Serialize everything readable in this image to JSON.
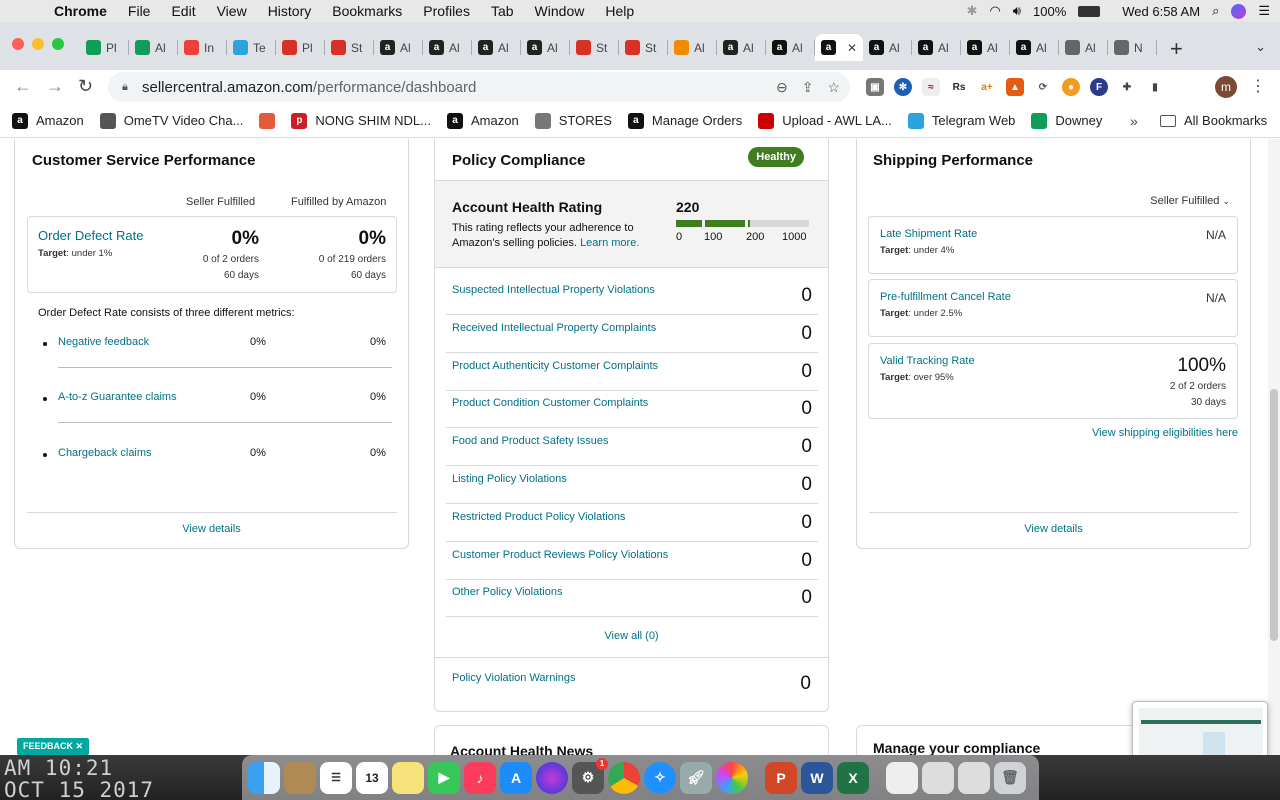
{
  "menubar": {
    "app": "Chrome",
    "items": [
      "File",
      "Edit",
      "View",
      "History",
      "Bookmarks",
      "Profiles",
      "Tab",
      "Window",
      "Help"
    ],
    "battery": "100%",
    "clock": "Wed 6:58 AM"
  },
  "tabs": [
    {
      "letter": "Pl",
      "icon": "sheets-icon",
      "color": "#0f9d58"
    },
    {
      "letter": "Al",
      "icon": "sheets-icon",
      "color": "#0f9d58"
    },
    {
      "letter": "In",
      "icon": "gmail-icon",
      "color": "#ea4335"
    },
    {
      "letter": "Te",
      "icon": "telegram-icon",
      "color": "#2aa3e0"
    },
    {
      "letter": "Pl",
      "icon": "peppermint-icon",
      "color": "#d93025"
    },
    {
      "letter": "St",
      "icon": "peppermint-icon",
      "color": "#d93025"
    },
    {
      "letter": "Al",
      "icon": "amazon-icon",
      "color": "#222"
    },
    {
      "letter": "Al",
      "icon": "amazon-icon",
      "color": "#222"
    },
    {
      "letter": "Al",
      "icon": "amazon-icon",
      "color": "#222"
    },
    {
      "letter": "Al",
      "icon": "amazon-icon",
      "color": "#222"
    },
    {
      "letter": "St",
      "icon": "peppermint-icon",
      "color": "#d93025"
    },
    {
      "letter": "St",
      "icon": "peppermint-icon",
      "color": "#d93025"
    },
    {
      "letter": "Al",
      "icon": "pencil-icon",
      "color": "#f28b00"
    },
    {
      "letter": "Al",
      "icon": "amazon-icon",
      "color": "#222"
    },
    {
      "letter": "Al",
      "icon": "amazon-icon",
      "color": "#111"
    },
    {
      "letter": "",
      "icon": "amazon-icon",
      "color": "#111",
      "active": true
    },
    {
      "letter": "Al",
      "icon": "amazon-icon",
      "color": "#111"
    },
    {
      "letter": "Al",
      "icon": "amazon-icon",
      "color": "#111"
    },
    {
      "letter": "Al",
      "icon": "amazon-icon",
      "color": "#111"
    },
    {
      "letter": "Al",
      "icon": "amazon-icon",
      "color": "#111"
    },
    {
      "letter": "Al",
      "icon": "globe-icon",
      "color": "#666"
    },
    {
      "letter": "N",
      "icon": "chrome-icon",
      "color": "#666"
    }
  ],
  "url": {
    "host": "sellercentral.amazon.com",
    "path": "/performance/dashboard"
  },
  "bookmarks": [
    {
      "label": "Amazon",
      "icon": "amazon-icon",
      "color": "#111"
    },
    {
      "label": "OmeTV Video Cha...",
      "icon": "globe-icon",
      "color": "#555"
    },
    {
      "label": "",
      "icon": "gift-icon",
      "color": "#e35b3b"
    },
    {
      "label": "NONG SHIM NDL...",
      "icon": "pinterest-icon",
      "color": "#cb1f27"
    },
    {
      "label": "Amazon",
      "icon": "amazon-icon",
      "color": "#111"
    },
    {
      "label": "STORES",
      "icon": "folder-icon",
      "color": "#777"
    },
    {
      "label": "Manage Orders",
      "icon": "amazon-icon",
      "color": "#111"
    },
    {
      "label": "Upload - AWL LA...",
      "icon": "awl-icon",
      "color": "#c00"
    },
    {
      "label": "Telegram Web",
      "icon": "telegram-icon",
      "color": "#2aa3e0"
    },
    {
      "label": "Downey",
      "icon": "sheets-icon",
      "color": "#0f9d58"
    }
  ],
  "all_bookmarks": "All Bookmarks",
  "csp": {
    "title": "Customer Service Performance",
    "col1": "Seller Fulfilled",
    "col2": "Fulfilled by Amazon",
    "odr_label": "Order Defect Rate",
    "odr_target_prefix": "Target",
    "odr_target": ": under 1%",
    "odr_sf_value": "0%",
    "odr_sf_orders": "0 of 2 orders",
    "odr_sf_days": "60 days",
    "odr_fba_value": "0%",
    "odr_fba_orders": "0 of 219 orders",
    "odr_fba_days": "60 days",
    "consists": "Order Defect Rate consists of three different metrics:",
    "metrics": [
      {
        "label": "Negative feedback",
        "sf": "0%",
        "fba": "0%"
      },
      {
        "label": "A-to-z Guarantee claims",
        "sf": "0%",
        "fba": "0%"
      },
      {
        "label": "Chargeback claims",
        "sf": "0%",
        "fba": "0%"
      }
    ],
    "view_details": "View details"
  },
  "pc": {
    "title": "Policy Compliance",
    "badge": "Healthy",
    "ahr_title": "Account Health Rating",
    "ahr_desc": "This rating reflects your adherence to Amazon's selling policies.",
    "learn_more": "Learn more.",
    "score": "220",
    "score_value": 220,
    "ticks": [
      "0",
      "100",
      "200",
      "1000"
    ],
    "violations": [
      {
        "label": "Suspected Intellectual Property Violations",
        "count": "0"
      },
      {
        "label": "Received Intellectual Property Complaints",
        "count": "0"
      },
      {
        "label": "Product Authenticity Customer Complaints",
        "count": "0"
      },
      {
        "label": "Product Condition Customer Complaints",
        "count": "0"
      },
      {
        "label": "Food and Product Safety Issues",
        "count": "0"
      },
      {
        "label": "Listing Policy Violations",
        "count": "0"
      },
      {
        "label": "Restricted Product Policy Violations",
        "count": "0"
      },
      {
        "label": "Customer Product Reviews Policy Violations",
        "count": "0"
      },
      {
        "label": "Other Policy Violations",
        "count": "0"
      }
    ],
    "view_all": "View all (0)",
    "warnings_label": "Policy Violation Warnings",
    "warnings_count": "0"
  },
  "sp": {
    "title": "Shipping Performance",
    "filter": "Seller Fulfilled",
    "late_label": "Late Shipment Rate",
    "late_target": ": under 4%",
    "late_value": "N/A",
    "cancel_label": "Pre-fulfillment Cancel Rate",
    "cancel_target": ": under 2.5%",
    "cancel_value": "N/A",
    "vtr_label": "Valid Tracking Rate",
    "vtr_target": ": over 95%",
    "vtr_value": "100%",
    "vtr_orders": "2 of 2 orders",
    "vtr_days": "30 days",
    "eligibility_link": "View shipping eligibilities here",
    "view_details": "View details"
  },
  "lower": {
    "news_title": "Account Health News",
    "manage_title": "Manage your compliance"
  },
  "feedback": "FEEDBACK ✕",
  "desktop_clock": [
    "AM 10:21",
    "OCT 15 2017"
  ],
  "dock_calendar": "13",
  "dock_badge": "1",
  "colors": {
    "teal": "#007185",
    "healthy": "#3f7d20",
    "bar_empty": "#d5d9d9"
  }
}
